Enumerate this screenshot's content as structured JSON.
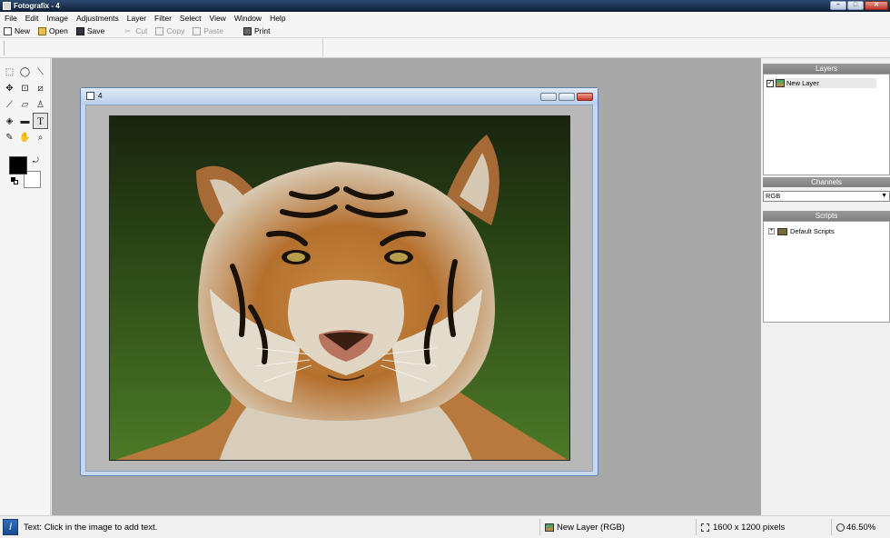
{
  "app": {
    "title": "Fotografix - 4"
  },
  "menu": [
    "File",
    "Edit",
    "Image",
    "Adjustments",
    "Layer",
    "Filter",
    "Select",
    "View",
    "Window",
    "Help"
  ],
  "toolbar": {
    "new_label": "New",
    "open_label": "Open",
    "save_label": "Save",
    "cut_label": "Cut",
    "copy_label": "Copy",
    "paste_label": "Paste",
    "print_label": "Print"
  },
  "tools": [
    {
      "name": "rect-select",
      "glyph": "⬚"
    },
    {
      "name": "ellipse-select",
      "glyph": "◯"
    },
    {
      "name": "magic-wand",
      "glyph": "⟋"
    },
    {
      "name": "move",
      "glyph": "✥"
    },
    {
      "name": "crop",
      "glyph": "⊡"
    },
    {
      "name": "paint-bucket-fill",
      "glyph": "⧄"
    },
    {
      "name": "brush",
      "glyph": "⟋"
    },
    {
      "name": "eraser",
      "glyph": "▱"
    },
    {
      "name": "clone-stamp",
      "glyph": "♙"
    },
    {
      "name": "fill",
      "glyph": "◈"
    },
    {
      "name": "gradient",
      "glyph": "▬"
    },
    {
      "name": "text",
      "glyph": "T"
    },
    {
      "name": "eyedropper",
      "glyph": "✎"
    },
    {
      "name": "hand",
      "glyph": "✋"
    },
    {
      "name": "zoom",
      "glyph": "🔍"
    }
  ],
  "active_tool": "text",
  "colors": {
    "foreground": "#000000",
    "background": "#ffffff",
    "titlebar": "#1a2f4d",
    "workspace": "#a8a8a8"
  },
  "document": {
    "name": "4"
  },
  "panels": {
    "layers": {
      "title": "Layers",
      "items": [
        {
          "name": "New Layer",
          "visible": true
        }
      ]
    },
    "channels": {
      "title": "Channels",
      "selected": "RGB"
    },
    "scripts": {
      "title": "Scripts",
      "items": [
        {
          "name": "Default Scripts"
        }
      ]
    }
  },
  "status": {
    "message": "Text: Click in the image to add text.",
    "layer": "New Layer (RGB)",
    "size": "1600 x 1200 pixels",
    "zoom": "46.50%"
  }
}
